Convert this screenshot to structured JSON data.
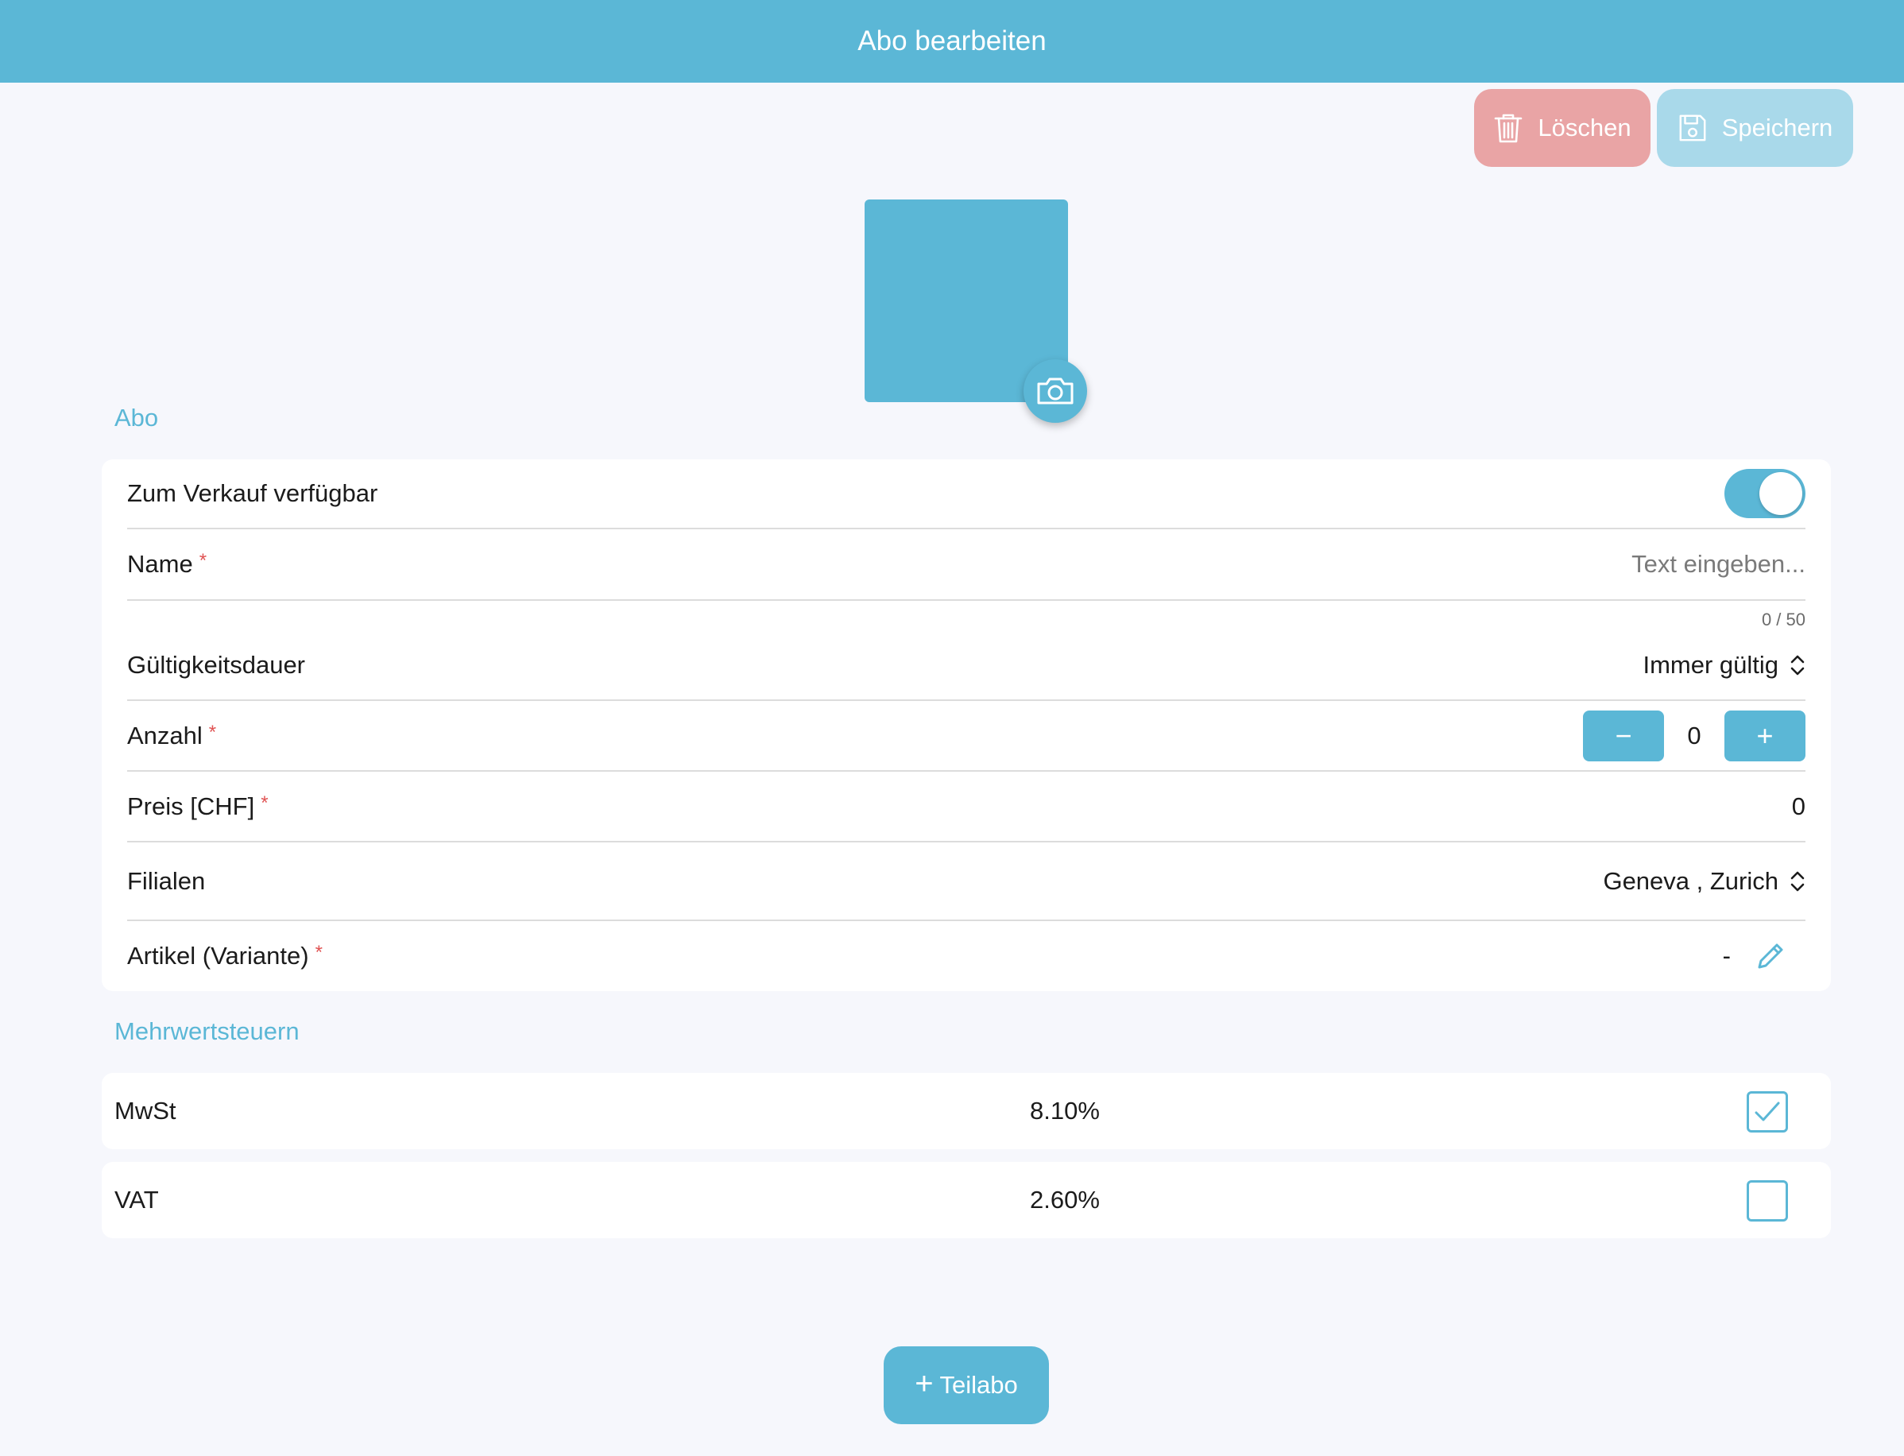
{
  "header": {
    "title": "Abo bearbeiten"
  },
  "actions": {
    "delete_label": "Löschen",
    "save_label": "Speichern"
  },
  "sections": {
    "abo_title": "Abo",
    "tax_title": "Mehrwertsteuern"
  },
  "form": {
    "available_label": "Zum Verkauf verfügbar",
    "available_on": true,
    "name_label": "Name",
    "name_placeholder": "Text eingeben...",
    "name_counter": "0 / 50",
    "validity_label": "Gültigkeitsdauer",
    "validity_value": "Immer gültig",
    "quantity_label": "Anzahl",
    "quantity_value": "0",
    "quantity_minus": "−",
    "quantity_plus": "+",
    "price_label": "Preis [CHF]",
    "price_value": "0",
    "branches_label": "Filialen",
    "branches_value": "Geneva , Zurich",
    "article_label": "Artikel (Variante)",
    "article_value": "-",
    "required_mark": "*"
  },
  "taxes": [
    {
      "name": "MwSt",
      "rate": "8.10%",
      "checked": true
    },
    {
      "name": "VAT",
      "rate": "2.60%",
      "checked": false
    }
  ],
  "add_button": {
    "label": "Teilabo",
    "icon": "+"
  },
  "colors": {
    "accent": "#5bb7d6",
    "delete": "#e9a4a5",
    "save_disabled": "#a9d9ea",
    "required": "#e05353"
  }
}
